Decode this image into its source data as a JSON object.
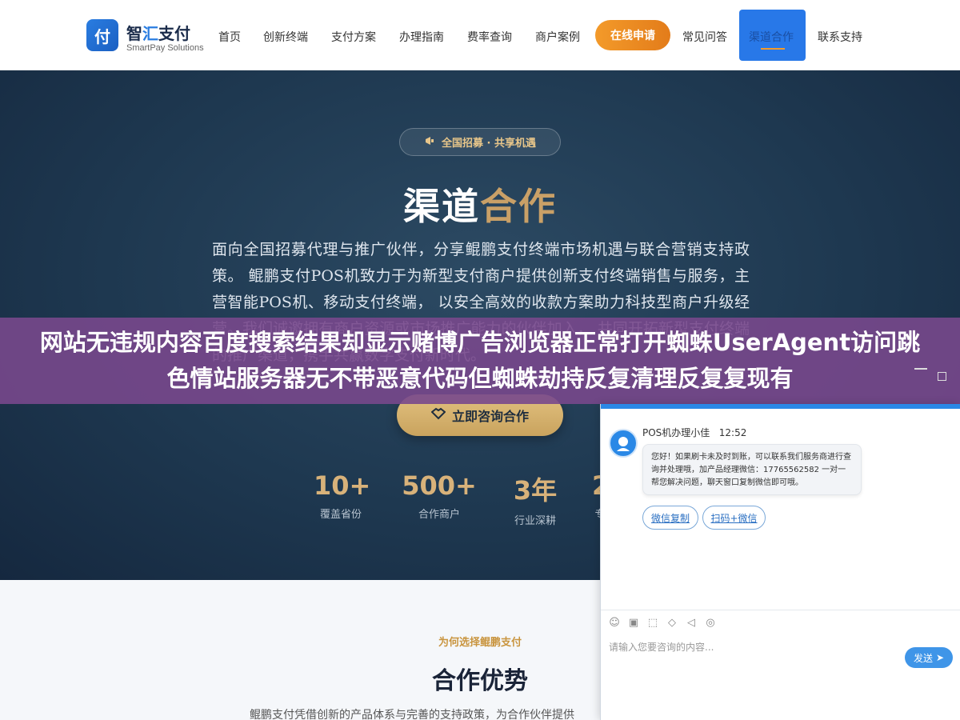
{
  "header": {
    "logo_glyph": "付",
    "logo_name_1": "智",
    "logo_name_2": "汇",
    "logo_name_3": "支付",
    "logo_sub": "SmartPay Solutions",
    "nav": [
      "首页",
      "创新终端",
      "支付方案",
      "办理指南",
      "费率查询",
      "商户案例"
    ],
    "apply_label": "在线申请",
    "faq_label": "常见问答",
    "active_label": "渠道合作",
    "contact_label": "联系支持",
    "accent_color": "#f39a2a",
    "active_color": "#2878e8"
  },
  "hero": {
    "badge_icon": "megaphone-icon",
    "badge_text": "全国招募 · 共享机遇",
    "title_white": "渠道",
    "title_gold": "合作",
    "description": "面向全国招募代理与推广伙伴，分享鲲鹏支付终端市场机遇与联合营销支持政策。 鲲鹏支付POS机致力于为新型支付商户提供创新支付终端销售与服务，主营智能POS机、移动支付终端， 以安全高效的收款方案助力科技型商户升级经营。我们诚邀拥有商户资源或市场推广能力的伙伴加入， 共同开拓新型支付终端的推广渠道，携手共赢数字支付新时代。",
    "cta_icon": "handshake-icon",
    "cta_label": "立即咨询合作",
    "stats": [
      {
        "num": "10+",
        "label": "覆盖省份"
      },
      {
        "num": "500+",
        "label": "合作商户"
      },
      {
        "num": "3年",
        "label": "行业深耕"
      },
      {
        "num": "2",
        "label": "专"
      }
    ]
  },
  "section": {
    "subtitle": "为何选择鲲鹏支付",
    "title": "合作优势",
    "description": "鲲鹏支付凭借创新的产品体系与完善的支持政策，为合作伙伴提供"
  },
  "banner": {
    "text": "网站无违规内容百度搜索结果却显示赌博广告浏览器正常打开蜘蛛UserAgent访问跳色情站服务器无不带恶意代码但蜘蛛劫持反复清理反复复现有"
  },
  "chat": {
    "agent_name": "POS机办理小佳",
    "time": "12:52",
    "message": "您好！如果刷卡未及时到账，可以联系我们服务商进行查询并处理哦，加产品经理微信：17765562582 一对一帮您解决问题，聊天窗口复制微信即可哦。",
    "link_copy": "微信复制",
    "link_scan": "扫码+微信",
    "tools": [
      "emoji-icon",
      "image-icon",
      "screenshot-icon",
      "shield-icon",
      "voice-icon",
      "chat-icon"
    ],
    "input_placeholder": "请输入您要咨询的内容...",
    "send_label": "发送"
  }
}
